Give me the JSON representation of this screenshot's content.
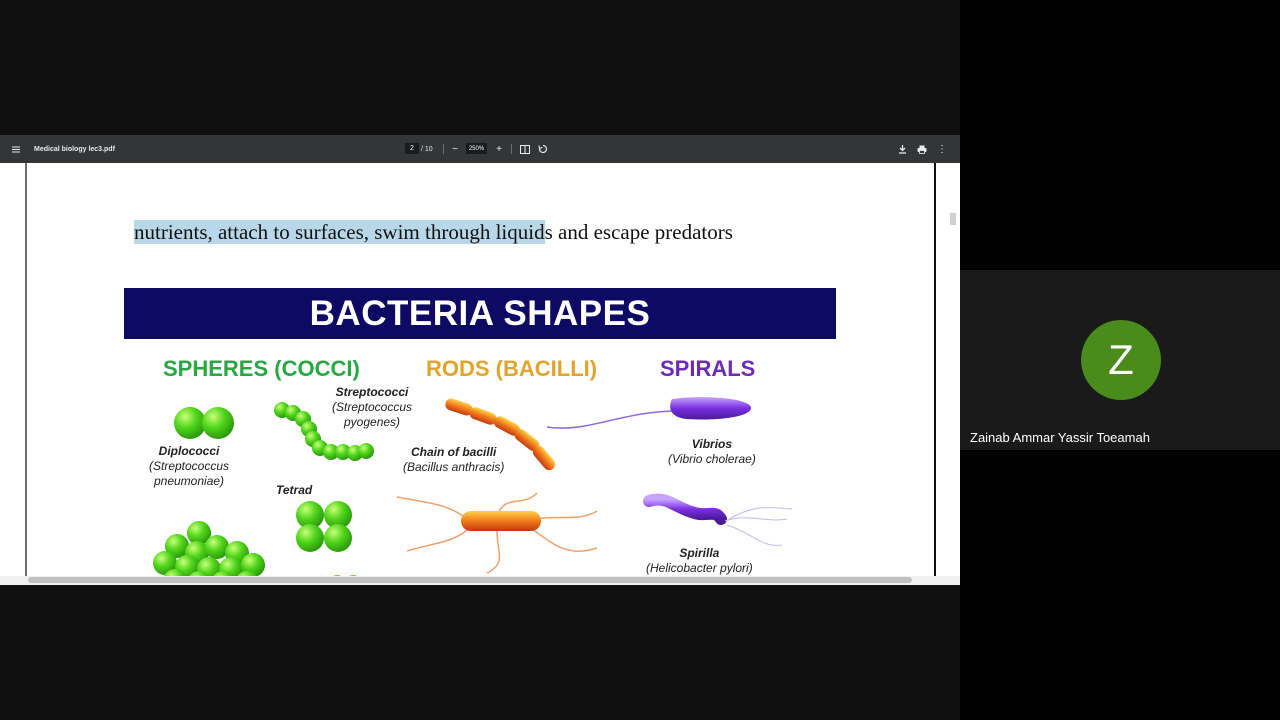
{
  "viewer": {
    "file_name": "Medical biology lec3.pdf",
    "current_page": "2",
    "total_pages": "/ 10",
    "zoom": "250%",
    "icons": {
      "menu": "hamburger-icon",
      "zoom_out": "minus-icon",
      "zoom_in": "plus-icon",
      "fit": "fit-page-icon",
      "rotate": "rotate-icon",
      "download": "download-icon",
      "print": "print-icon",
      "more": "more-vert-icon"
    },
    "glyphs": {
      "zoom_out": "−",
      "zoom_in": "+",
      "more": "⋮"
    }
  },
  "document": {
    "sentence_highlighted": "nutrients, attach to surfaces, swim through liquid",
    "sentence_rest": "s and escape predators",
    "figure": {
      "banner": "BACTERIA SHAPES",
      "categories": {
        "cocci": "SPHERES (COCCI)",
        "bacilli": "RODS (BACILLI)",
        "spirals": "SPIRALS"
      },
      "labels": {
        "streptococci_name": "Streptococci",
        "streptococci_species": "(Streptococcus",
        "streptococci_species2": "pyogenes)",
        "diplococci_name": "Diplococci",
        "diplococci_species": "(Streptococcus",
        "diplococci_species2": "pneumoniae)",
        "tetrad_name": "Tetrad",
        "chain_name": "Chain of bacilli",
        "chain_species": "(Bacillus anthracis)",
        "vibrios_name": "Vibrios",
        "vibrios_species": "(Vibrio cholerae)",
        "spirilla_name": "Spirilla",
        "spirilla_species": "(Helicobacter pylori)"
      }
    }
  },
  "participant": {
    "initial": "Z",
    "name": "Zainab Ammar Yassir Toeamah",
    "avatar_color": "#4a8c1c"
  }
}
